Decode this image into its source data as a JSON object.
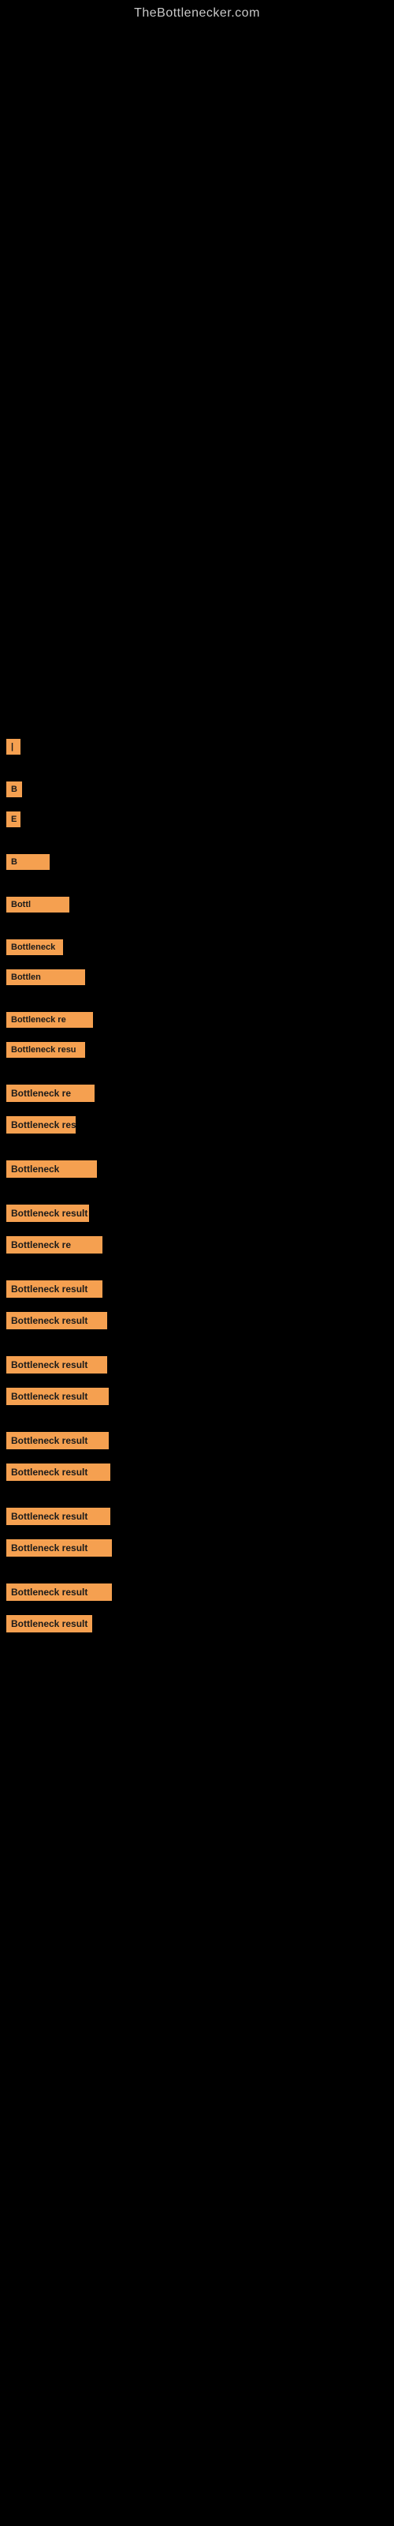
{
  "site": {
    "title": "TheBottlenecker.com"
  },
  "results": [
    {
      "id": 1,
      "label": "|",
      "width": 18
    },
    {
      "id": 2,
      "label": "B",
      "width": 20
    },
    {
      "id": 3,
      "label": "E",
      "width": 18
    },
    {
      "id": 4,
      "label": "B",
      "width": 18
    },
    {
      "id": 5,
      "label": "Bottl",
      "width": 55
    },
    {
      "id": 6,
      "label": "Bottleneck",
      "width": 80
    },
    {
      "id": 7,
      "label": "Bottlen",
      "width": 72
    },
    {
      "id": 8,
      "label": "Bottleneck re",
      "width": 100
    },
    {
      "id": 9,
      "label": "Bottleneck resu",
      "width": 110
    },
    {
      "id": 10,
      "label": "Bottleneck re",
      "width": 100
    },
    {
      "id": 11,
      "label": "Bottleneck res",
      "width": 112
    },
    {
      "id": 12,
      "label": "Bottleneck",
      "width": 88
    },
    {
      "id": 13,
      "label": "Bottleneck result",
      "width": 115
    },
    {
      "id": 14,
      "label": "Bottleneck re",
      "width": 105
    },
    {
      "id": 15,
      "label": "Bottleneck result",
      "width": 122
    },
    {
      "id": 16,
      "label": "Bottleneck result",
      "width": 122
    },
    {
      "id": 17,
      "label": "Bottleneck result",
      "width": 128
    },
    {
      "id": 18,
      "label": "Bottleneck result",
      "width": 128
    },
    {
      "id": 19,
      "label": "Bottleneck result",
      "width": 130
    },
    {
      "id": 20,
      "label": "Bottleneck result",
      "width": 130
    },
    {
      "id": 21,
      "label": "Bottleneck result",
      "width": 132
    },
    {
      "id": 22,
      "label": "Bottleneck result",
      "width": 132
    },
    {
      "id": 23,
      "label": "Bottleneck result",
      "width": 134
    },
    {
      "id": 24,
      "label": "Bottleneck result",
      "width": 134
    }
  ]
}
